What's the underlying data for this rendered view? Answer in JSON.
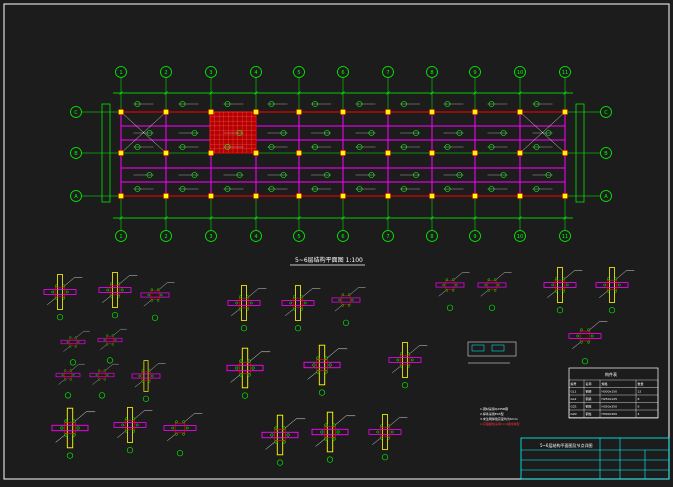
{
  "drawing": {
    "plan_title": "5~6层结构平面图 1:100",
    "axis_labels_top": [
      "1",
      "2",
      "3",
      "4",
      "5",
      "6",
      "7",
      "8",
      "9",
      "10",
      "11"
    ],
    "axis_labels_side": [
      "C",
      "B",
      "A"
    ],
    "title_block_name": "5~6层结构平面图及节点详图",
    "table_title": "构件表",
    "table_headers": [
      "编号",
      "名称",
      "规格",
      "数量"
    ],
    "table_rows": [
      [
        "GL1",
        "钢梁",
        "H300x150",
        "12"
      ],
      [
        "GL2",
        "钢梁",
        "H250x125",
        "8"
      ],
      [
        "GZ1",
        "钢柱",
        "H350x350",
        "6"
      ],
      [
        "GZ2",
        "钢柱",
        "H300x300",
        "4"
      ]
    ],
    "notes": [
      "1.钢材采用Q235B钢",
      "2.焊条采用E43型",
      "3.未注明焊缝高度均为6mm",
      "4.高强螺栓采用10.9级摩擦型"
    ],
    "colors": {
      "background": "#1c1c1c",
      "grid": "#00ff00",
      "beam": "#ff00ff",
      "column": "#ff0000",
      "text": "#ffffff",
      "yellow": "#ffff00",
      "cyan": "#00ffff"
    }
  }
}
